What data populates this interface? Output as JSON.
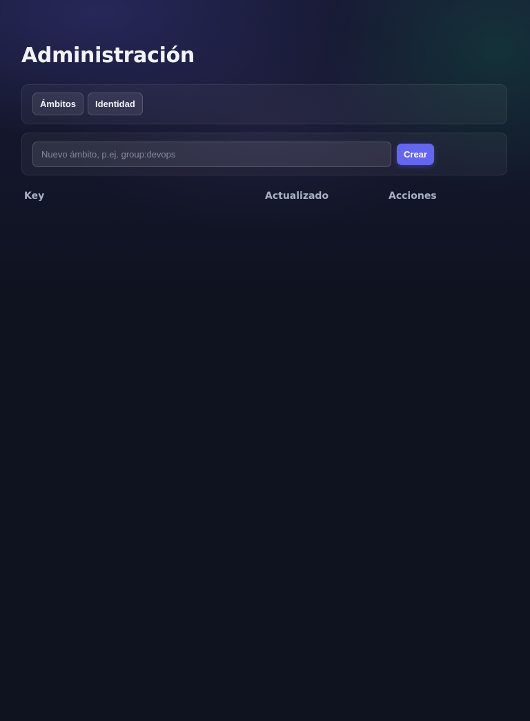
{
  "page": {
    "title": "Administración"
  },
  "tabs": [
    {
      "label": "Ámbitos"
    },
    {
      "label": "Identidad"
    }
  ],
  "create_form": {
    "input_value": "",
    "input_placeholder": "Nuevo ámbito, p.ej. group:devops",
    "submit_label": "Crear"
  },
  "table": {
    "columns": [
      "Key",
      "Actualizado",
      "Acciones"
    ],
    "rows": []
  },
  "colors": {
    "accent": "#6366f1",
    "background": "#0f1320"
  }
}
